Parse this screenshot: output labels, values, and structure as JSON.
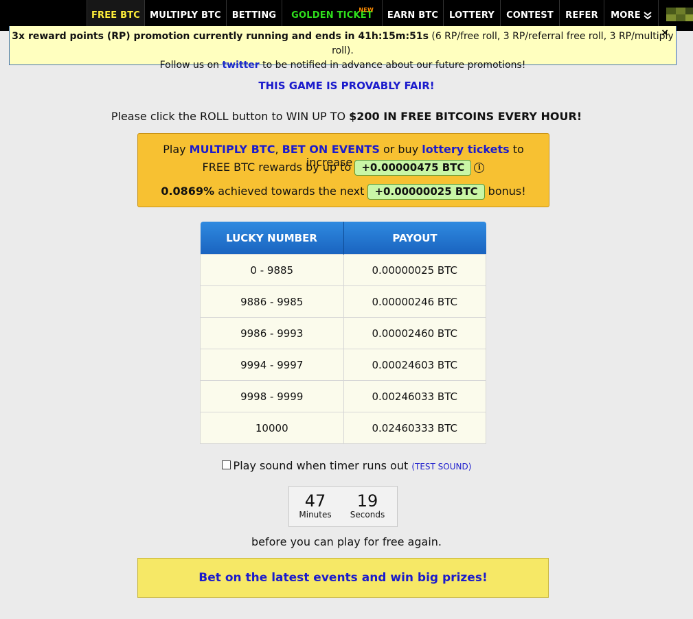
{
  "nav": {
    "items": [
      {
        "label": "FREE BTC"
      },
      {
        "label": "MULTIPLY BTC"
      },
      {
        "label": "BETTING"
      },
      {
        "label": "GOLDEN TICKET",
        "badge": "NEW"
      },
      {
        "label": "EARN BTC"
      },
      {
        "label": "LOTTERY"
      },
      {
        "label": "CONTEST"
      },
      {
        "label": "REFER"
      },
      {
        "label": "MORE",
        "icon": "double-chevron-down-icon"
      }
    ],
    "colors": {
      "active_text": "#ffef3a",
      "golden_text": "#2fe01c",
      "new_badge": "#ff8c00"
    }
  },
  "promo": {
    "bold_part": "3x reward points (RP) promotion currently running and ends in 41h:15m:51s",
    "detail": " (6 RP/free roll, 3 RP/referral free roll, 3 RP/multiply roll).",
    "follow_prefix": "Follow us on ",
    "twitter_link": "twitter",
    "follow_suffix": " to be notified in advance about our future promotions!",
    "close": "×"
  },
  "provably_fair": "THIS GAME IS PROVABLY FAIR!",
  "roll_message": {
    "prefix": "Please click the ROLL button to WIN UP TO ",
    "bold": "$200 IN FREE BITCOINS EVERY HOUR!"
  },
  "rewards_box": {
    "play": "Play ",
    "multiply_link": "MULTIPLY BTC",
    "comma": ", ",
    "bet_link": "BET ON EVENTS",
    "or_buy": " or buy ",
    "lottery_link": "lottery tickets",
    "increase": " to increase your",
    "free_btc_prefix": "FREE BTC rewards by up to ",
    "bonus_amount": "+0.00000475 BTC",
    "info_icon": "i",
    "achieved_pct": "0.0869%",
    "achieved_text": " achieved towards the next ",
    "next_bonus": "+0.00000025 BTC",
    "bonus_word": " bonus!"
  },
  "payout_table": {
    "headers": [
      "LUCKY NUMBER",
      "PAYOUT"
    ],
    "rows": [
      [
        "0 - 9885",
        "0.00000025 BTC"
      ],
      [
        "9886 - 9985",
        "0.00000246 BTC"
      ],
      [
        "9986 - 9993",
        "0.00002460 BTC"
      ],
      [
        "9994 - 9997",
        "0.00024603 BTC"
      ],
      [
        "9998 - 9999",
        "0.00246033 BTC"
      ],
      [
        "10000",
        "0.02460333 BTC"
      ]
    ]
  },
  "sound": {
    "label": "Play sound when timer runs out ",
    "test_link": "(TEST SOUND)",
    "checked": false
  },
  "timer": {
    "minutes": "47",
    "minutes_label": "Minutes",
    "seconds": "19",
    "seconds_label": "Seconds"
  },
  "before_text": "before you can play for free again.",
  "bet_banner": "Bet on the latest events and win big prizes!"
}
